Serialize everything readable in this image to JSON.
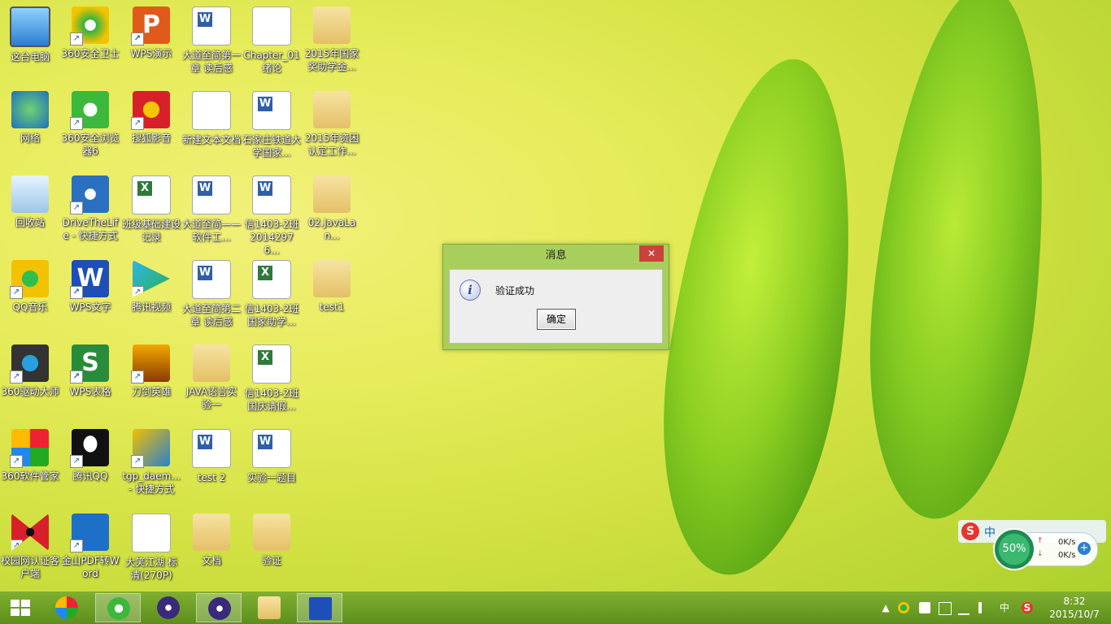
{
  "desktop": {
    "icons": [
      {
        "id": "pc",
        "label": "这台电脑",
        "glyph": "g-pc",
        "shortcut": false
      },
      {
        "id": "360safe",
        "label": "360安全卫士",
        "glyph": "g-360",
        "shortcut": true
      },
      {
        "id": "wpsp",
        "label": "WPS演示",
        "glyph": "g-wps-p",
        "glyph_text": "P",
        "shortcut": true
      },
      {
        "id": "dadao1",
        "label": "大道至简第一章 读后感",
        "glyph": "g-doc",
        "shortcut": false
      },
      {
        "id": "chapter01",
        "label": "Chapter_01 绪论",
        "glyph": "g-chapter",
        "shortcut": false
      },
      {
        "id": "y2015a",
        "label": "2015年国家奖助学金...",
        "glyph": "g-folder",
        "shortcut": false
      },
      {
        "id": "network",
        "label": "网络",
        "glyph": "g-net",
        "shortcut": false
      },
      {
        "id": "360browser",
        "label": "360安全浏览器6",
        "glyph": "g-ie",
        "shortcut": true
      },
      {
        "id": "sohu",
        "label": "搜狐影音",
        "glyph": "g-sohu",
        "shortcut": true
      },
      {
        "id": "newtxt",
        "label": "新建文本文档",
        "glyph": "g-txt",
        "shortcut": false
      },
      {
        "id": "sjz",
        "label": "石家庄铁道大学国家...",
        "glyph": "g-doc",
        "shortcut": false
      },
      {
        "id": "y2015b",
        "label": "2015年资困认定工作...",
        "glyph": "g-folder",
        "shortcut": false
      },
      {
        "id": "recycle",
        "label": "回收站",
        "glyph": "g-bin",
        "shortcut": false
      },
      {
        "id": "drivethelife",
        "label": "DriveTheLife - 快捷方式",
        "glyph": "g-gear",
        "shortcut": true
      },
      {
        "id": "banji",
        "label": "班级基础建设记录",
        "glyph": "g-xls",
        "shortcut": false
      },
      {
        "id": "dadao2",
        "label": "大道至简——软件工...",
        "glyph": "g-doc",
        "shortcut": false
      },
      {
        "id": "xin1",
        "label": "信1403-2班20142976...",
        "glyph": "g-doc",
        "shortcut": false
      },
      {
        "id": "javalan",
        "label": "02.JavaLan...",
        "glyph": "g-folder",
        "shortcut": false
      },
      {
        "id": "qqmusic",
        "label": "QQ音乐",
        "glyph": "g-qqmusic",
        "shortcut": true
      },
      {
        "id": "wpsw",
        "label": "WPS文字",
        "glyph": "g-wps-w",
        "glyph_text": "W",
        "shortcut": true
      },
      {
        "id": "tencentvideo",
        "label": "腾讯视频",
        "glyph": "g-tv",
        "shortcut": true
      },
      {
        "id": "dadao3",
        "label": "大道至简第二章 读后感",
        "glyph": "g-doc",
        "shortcut": false
      },
      {
        "id": "xin2",
        "label": "信1403-2班国家助学...",
        "glyph": "g-xls",
        "shortcut": false
      },
      {
        "id": "test1",
        "label": "test1",
        "glyph": "g-folder",
        "shortcut": false
      },
      {
        "id": "360driver",
        "label": "360驱动大师",
        "glyph": "g-drv",
        "shortcut": true
      },
      {
        "id": "wpss",
        "label": "WPS表格",
        "glyph": "g-wps-s",
        "glyph_text": "S",
        "shortcut": true
      },
      {
        "id": "daojian",
        "label": "刀剑英雄",
        "glyph": "g-game",
        "shortcut": true
      },
      {
        "id": "java1",
        "label": "JAVA语言实验一",
        "glyph": "g-folder",
        "shortcut": false
      },
      {
        "id": "xin3",
        "label": "信1403-2班国庆请假...",
        "glyph": "g-xls",
        "shortcut": false
      },
      {
        "id": "empty1",
        "label": "",
        "glyph": "",
        "shortcut": false
      },
      {
        "id": "360soft",
        "label": "360软件管家",
        "glyph": "g-soft",
        "shortcut": true
      },
      {
        "id": "qq",
        "label": "腾讯QQ",
        "glyph": "g-qq",
        "shortcut": true
      },
      {
        "id": "tgp",
        "label": "tgp_daem... - 快捷方式",
        "glyph": "g-tgp",
        "shortcut": true
      },
      {
        "id": "test2",
        "label": "test 2",
        "glyph": "g-doc",
        "shortcut": false
      },
      {
        "id": "shiyan1",
        "label": "实验一题目",
        "glyph": "g-doc",
        "shortcut": false
      },
      {
        "id": "empty2",
        "label": "",
        "glyph": "",
        "shortcut": false
      },
      {
        "id": "campus",
        "label": "校园网认证客户端",
        "glyph": "g-butterfly",
        "shortcut": true
      },
      {
        "id": "pdf",
        "label": "金山PDF转Word",
        "glyph": "g-pdf",
        "shortcut": true
      },
      {
        "id": "dxjh",
        "label": "大笑江湖 标清(270P)",
        "glyph": "g-video",
        "shortcut": false
      },
      {
        "id": "wendang",
        "label": "文档",
        "glyph": "g-folder",
        "shortcut": false
      },
      {
        "id": "yanzheng",
        "label": "验证",
        "glyph": "g-folder",
        "shortcut": false
      }
    ]
  },
  "dialog": {
    "title": "消息",
    "close_glyph": "✕",
    "info_glyph": "i",
    "message": "验证成功",
    "ok_label": "确定"
  },
  "widget": {
    "ime_logo": "S",
    "ime_mode": "中",
    "gauge": "50%",
    "upload": "0K/s",
    "download": "0K/s",
    "up_arrow": "↑",
    "down_arrow": "↓",
    "plus": "+"
  },
  "taskbar": {
    "tray": {
      "chevron": "▲",
      "ime": "中",
      "sogou": "S"
    },
    "clock": {
      "time": "8:32",
      "date": "2015/10/7"
    }
  },
  "colors": {
    "taskbar": "#6a9a24",
    "dialog_frame": "#a8cf5c",
    "close_button": "#c9433a"
  }
}
